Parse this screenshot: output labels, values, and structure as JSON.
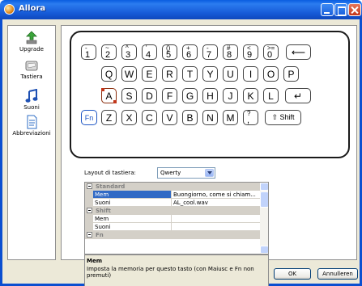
{
  "window": {
    "title": "Allora"
  },
  "sidebar": {
    "items": [
      {
        "label": "Upgrade",
        "icon": "upgrade-icon"
      },
      {
        "label": "Tastiera",
        "icon": "keyboard-icon"
      },
      {
        "label": "Suoni",
        "icon": "music-note-icon"
      },
      {
        "label": "Abbreviazioni",
        "icon": "document-icon"
      }
    ]
  },
  "keyboard": {
    "row1": [
      {
        "up": "-",
        "dn": "1"
      },
      {
        "up": "~",
        "dn": "2"
      },
      {
        "up": "^",
        "dn": "3"
      },
      {
        "up": "'",
        "dn": "4"
      },
      {
        "up": "()",
        "dn": "5"
      },
      {
        "up": "+",
        "dn": "6"
      },
      {
        "up": "-",
        "dn": "7"
      },
      {
        "up": "#",
        "dn": "8"
      },
      {
        "up": "<",
        "dn": "9"
      },
      {
        "up": ">=",
        "dn": "0"
      }
    ],
    "backspace": "⟵",
    "row2": [
      "Q",
      "W",
      "E",
      "R",
      "T",
      "Y",
      "U",
      "I",
      "O",
      "P"
    ],
    "row3": [
      "A",
      "S",
      "D",
      "F",
      "G",
      "H",
      "J",
      "K",
      "L"
    ],
    "enter": "↵",
    "fn": "Fn",
    "row4": [
      "Z",
      "X",
      "C",
      "V",
      "B",
      "N",
      "M"
    ],
    "punct": {
      "up": "?",
      "dn": ","
    },
    "shift": "⇧ Shift"
  },
  "layout": {
    "label": "Layout di tastiera:",
    "value": "Qwerty"
  },
  "grid": {
    "categories": [
      {
        "label": "Standard",
        "rows": [
          {
            "name": "Mem",
            "value": "Buongiorno, come si chiam...",
            "selected": true
          },
          {
            "name": "Suoni",
            "value": "AL_cool.wav"
          }
        ]
      },
      {
        "label": "Shift",
        "rows": [
          {
            "name": "Mem",
            "value": ""
          },
          {
            "name": "Suoni",
            "value": ""
          }
        ]
      },
      {
        "label": "Fn",
        "rows": []
      }
    ]
  },
  "description": {
    "title": "Mem",
    "text": "Imposta la memoria per questo tasto (con Maiusc e Fn non premuti)"
  },
  "buttons": {
    "ok": "OK",
    "cancel": "Annulleren"
  }
}
